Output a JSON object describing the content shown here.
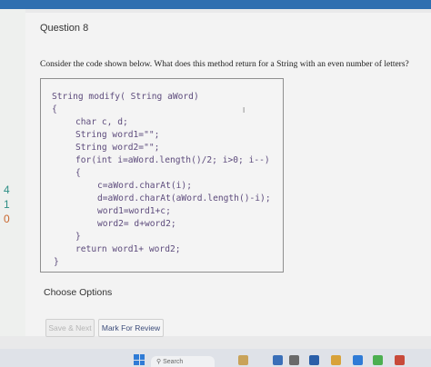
{
  "question": {
    "title": "Question 8",
    "text": "Consider the code shown below. What does this method return for a String with an even number of letters?"
  },
  "code": {
    "lines": [
      "String modify( String aWord)",
      "{",
      "char c, d;",
      "String word1=\"\";",
      "String word2=\"\";",
      "for(int i=aWord.length()/2; i>0; i--)",
      "{",
      "c=aWord.charAt(i);",
      "d=aWord.charAt(aWord.length()-i);",
      "word1=word1+c;",
      "word2= d+word2;",
      "}",
      "return word1+ word2;",
      "}"
    ]
  },
  "options_heading": "Choose Options",
  "buttons": {
    "save_next": "Save & Next",
    "mark_review": "Mark For Review"
  },
  "side_numbers": [
    "4",
    "1",
    "0"
  ],
  "taskbar": {
    "search_label": "Search"
  },
  "colors": {
    "accent_bar": "#2f6fb0",
    "code_text": "#5d4b7c",
    "windows_blue": "#2f7bd6"
  }
}
